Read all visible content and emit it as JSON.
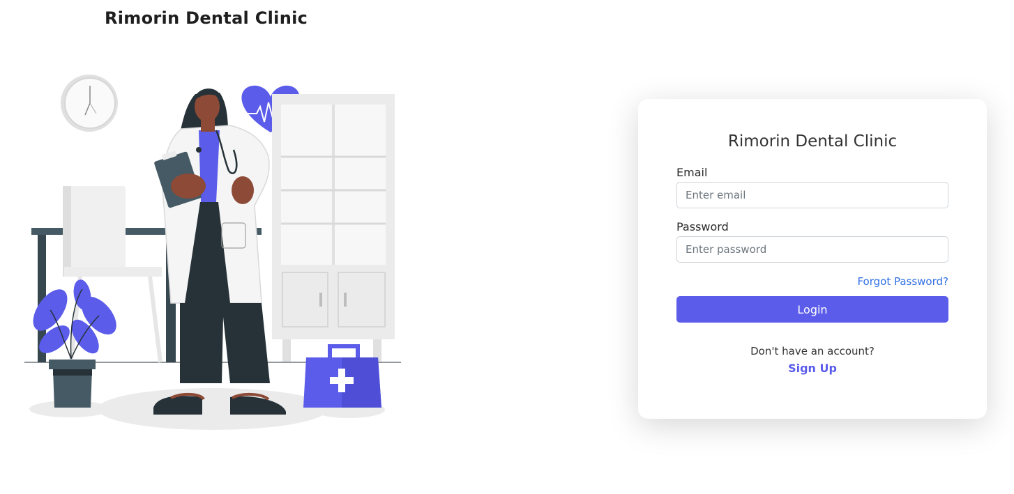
{
  "header": {
    "brand_title": "Rimorin Dental Clinic"
  },
  "illustration": {
    "name": "doctor-in-clinic-illustration",
    "accent_color": "#5b5cea"
  },
  "login_card": {
    "title": "Rimorin Dental Clinic",
    "email": {
      "label": "Email",
      "placeholder": "Enter email",
      "value": ""
    },
    "password": {
      "label": "Password",
      "placeholder": "Enter password",
      "value": ""
    },
    "forgot_password": "Forgot Password?",
    "login_button": "Login",
    "no_account_text": "Don't have an account?",
    "signup_link": "Sign Up"
  },
  "colors": {
    "accent": "#5b5cea",
    "link": "#2f6fe4",
    "text": "#333333"
  }
}
